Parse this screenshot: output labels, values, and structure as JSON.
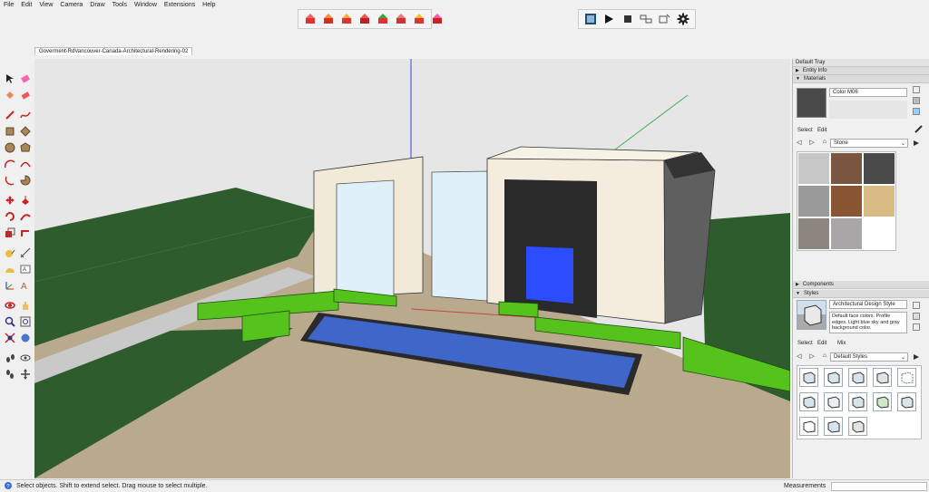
{
  "menu": [
    "File",
    "Edit",
    "View",
    "Camera",
    "Draw",
    "Tools",
    "Window",
    "Extensions",
    "Help"
  ],
  "document_tab": "Goverment-RdVancouver-Canada-Architectural-Rendering-02",
  "status_text": "Select objects. Shift to extend select. Drag mouse to select multiple.",
  "measurements_label": "Measurements",
  "tray": {
    "title": "Default Tray",
    "entity_info": "Entity Info",
    "materials": "Materials",
    "material_name": "Color M06",
    "select_tab": "Select",
    "edit_tab": "Edit",
    "mix_tab": "Mix",
    "library": "Stone",
    "components": "Components",
    "styles": "Styles",
    "style_name": "Architectural Design Style",
    "style_desc": "Default face colors. Profile edges. Light blue sky and gray background color.",
    "styles_library": "Default Styles"
  },
  "colors": {
    "ground": "#b9aa8e",
    "grass": "#2e5c2d",
    "sky": "#e6e6e6",
    "hedge": "#56c21c",
    "pool": "#3f67c9",
    "glass": "#dff0f8",
    "wall": "#f4ecdc",
    "dark_wall": "#5f5f5f",
    "accent": "#2b4cff"
  },
  "swatches": [
    "#c7c7c7",
    "#7a5540",
    "#4a4a4a",
    "#9a9a9a",
    "#8a5532",
    "#d8bc84",
    "#8d8680",
    "#a8a6a6"
  ]
}
